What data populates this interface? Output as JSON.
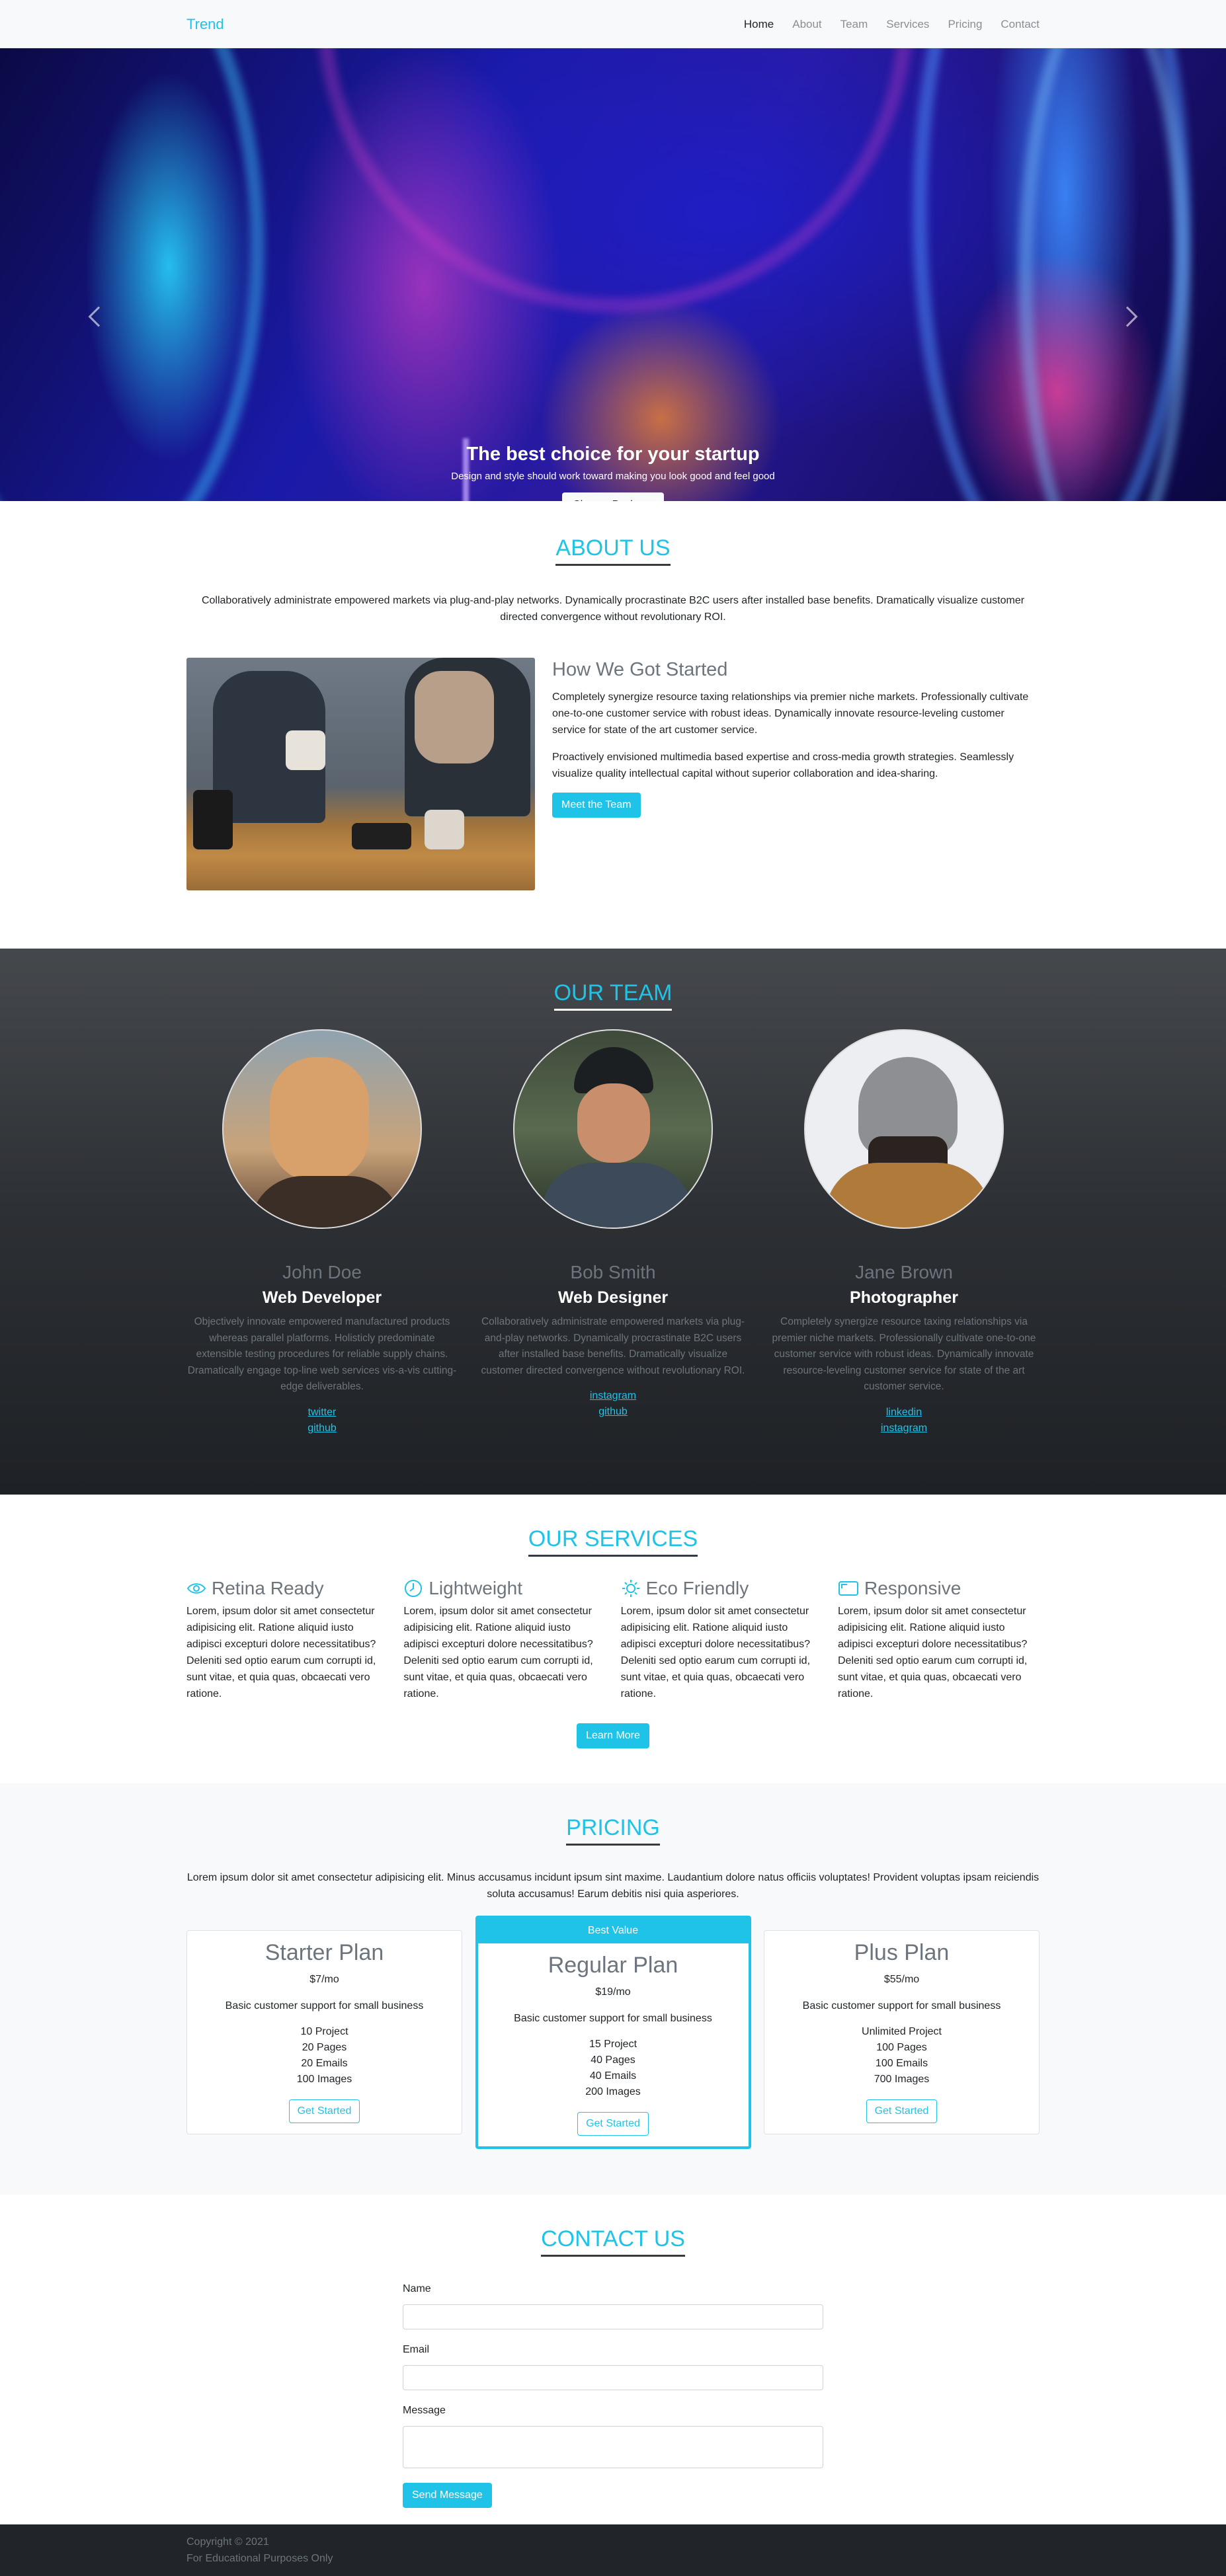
{
  "nav": {
    "brand": "Trend",
    "links": [
      "Home",
      "About",
      "Team",
      "Services",
      "Pricing",
      "Contact"
    ]
  },
  "hero": {
    "title": "The best choice for your startup",
    "subtitle": "Design and style should work toward making you look good and feel good",
    "button": "Choose Package"
  },
  "about": {
    "heading": "ABOUT US",
    "intro": "Collaboratively administrate empowered markets via plug-and-play networks. Dynamically procrastinate B2C users after installed base benefits. Dramatically visualize customer directed convergence without revolutionary ROI.",
    "subheading": "How We Got Started",
    "para1": "Completely synergize resource taxing relationships via premier niche markets. Professionally cultivate one-to-one customer service with robust ideas. Dynamically innovate resource-leveling customer service for state of the art customer service.",
    "para2": "Proactively envisioned multimedia based expertise and cross-media growth strategies. Seamlessly visualize quality intellectual capital without superior collaboration and idea-sharing.",
    "button": "Meet the Team"
  },
  "team": {
    "heading": "OUR TEAM",
    "members": [
      {
        "name": "John Doe",
        "role": "Web Developer",
        "bio": "Objectively innovate empowered manufactured products whereas parallel platforms. Holisticly predominate extensible testing procedures for reliable supply chains. Dramatically engage top-line web services vis-a-vis cutting-edge deliverables.",
        "links": [
          "twitter",
          "github"
        ]
      },
      {
        "name": "Bob Smith",
        "role": "Web Designer",
        "bio": "Collaboratively administrate empowered markets via plug-and-play networks. Dynamically procrastinate B2C users after installed base benefits. Dramatically visualize customer directed convergence without revolutionary ROI.",
        "links": [
          "instagram",
          "github"
        ]
      },
      {
        "name": "Jane Brown",
        "role": "Photographer",
        "bio": "Completely synergize resource taxing relationships via premier niche markets. Professionally cultivate one-to-one customer service with robust ideas. Dynamically innovate resource-leveling customer service for state of the art customer service.",
        "links": [
          "linkedin",
          "instagram"
        ]
      }
    ]
  },
  "services": {
    "heading": "OUR SERVICES",
    "items": [
      {
        "title": "Retina Ready",
        "icon": "eye-icon",
        "text": "Lorem, ipsum dolor sit amet consectetur adipisicing elit. Ratione aliquid iusto adipisci excepturi dolore necessitatibus? Deleniti sed optio earum cum corrupti id, sunt vitae, et quia quas, obcaecati vero ratione."
      },
      {
        "title": "Lightweight",
        "icon": "clock-icon",
        "text": "Lorem, ipsum dolor sit amet consectetur adipisicing elit. Ratione aliquid iusto adipisci excepturi dolore necessitatibus? Deleniti sed optio earum cum corrupti id, sunt vitae, et quia quas, obcaecati vero ratione."
      },
      {
        "title": "Eco Friendly",
        "icon": "sun-icon",
        "text": "Lorem, ipsum dolor sit amet consectetur adipisicing elit. Ratione aliquid iusto adipisci excepturi dolore necessitatibus? Deleniti sed optio earum cum corrupti id, sunt vitae, et quia quas, obcaecati vero ratione."
      },
      {
        "title": "Responsive",
        "icon": "tablet-icon",
        "text": "Lorem, ipsum dolor sit amet consectetur adipisicing elit. Ratione aliquid iusto adipisci excepturi dolore necessitatibus? Deleniti sed optio earum cum corrupti id, sunt vitae, et quia quas, obcaecati vero ratione."
      }
    ],
    "button": "Learn More"
  },
  "pricing": {
    "heading": "PRICING",
    "intro": "Lorem ipsum dolor sit amet consectetur adipisicing elit. Minus accusamus incidunt ipsum sint maxime. Laudantium dolore natus officiis voluptates! Provident voluptas ipsam reiciendis soluta accusamus! Earum debitis nisi quia asperiores.",
    "plans": [
      {
        "name": "Starter Plan",
        "price": "$7/mo",
        "desc": "Basic customer support for small business",
        "features": [
          "10 Project",
          "20 Pages",
          "20 Emails",
          "100 Images"
        ],
        "button": "Get Started"
      },
      {
        "badge": "Best Value",
        "name": "Regular Plan",
        "price": "$19/mo",
        "desc": "Basic customer support for small business",
        "features": [
          "15 Project",
          "40 Pages",
          "40 Emails",
          "200 Images"
        ],
        "button": "Get Started"
      },
      {
        "name": "Plus Plan",
        "price": "$55/mo",
        "desc": "Basic customer support for small business",
        "features": [
          "Unlimited Project",
          "100 Pages",
          "100 Emails",
          "700 Images"
        ],
        "button": "Get Started"
      }
    ]
  },
  "contact": {
    "heading": "CONTACT US",
    "name_label": "Name",
    "email_label": "Email",
    "message_label": "Message",
    "button": "Send Message"
  },
  "footer": {
    "copyright": "Copyright © 2021",
    "note": "For Educational Purposes Only"
  },
  "colors": {
    "accent": "#20c3e8",
    "dark": "#212529",
    "muted": "#6c757d"
  }
}
